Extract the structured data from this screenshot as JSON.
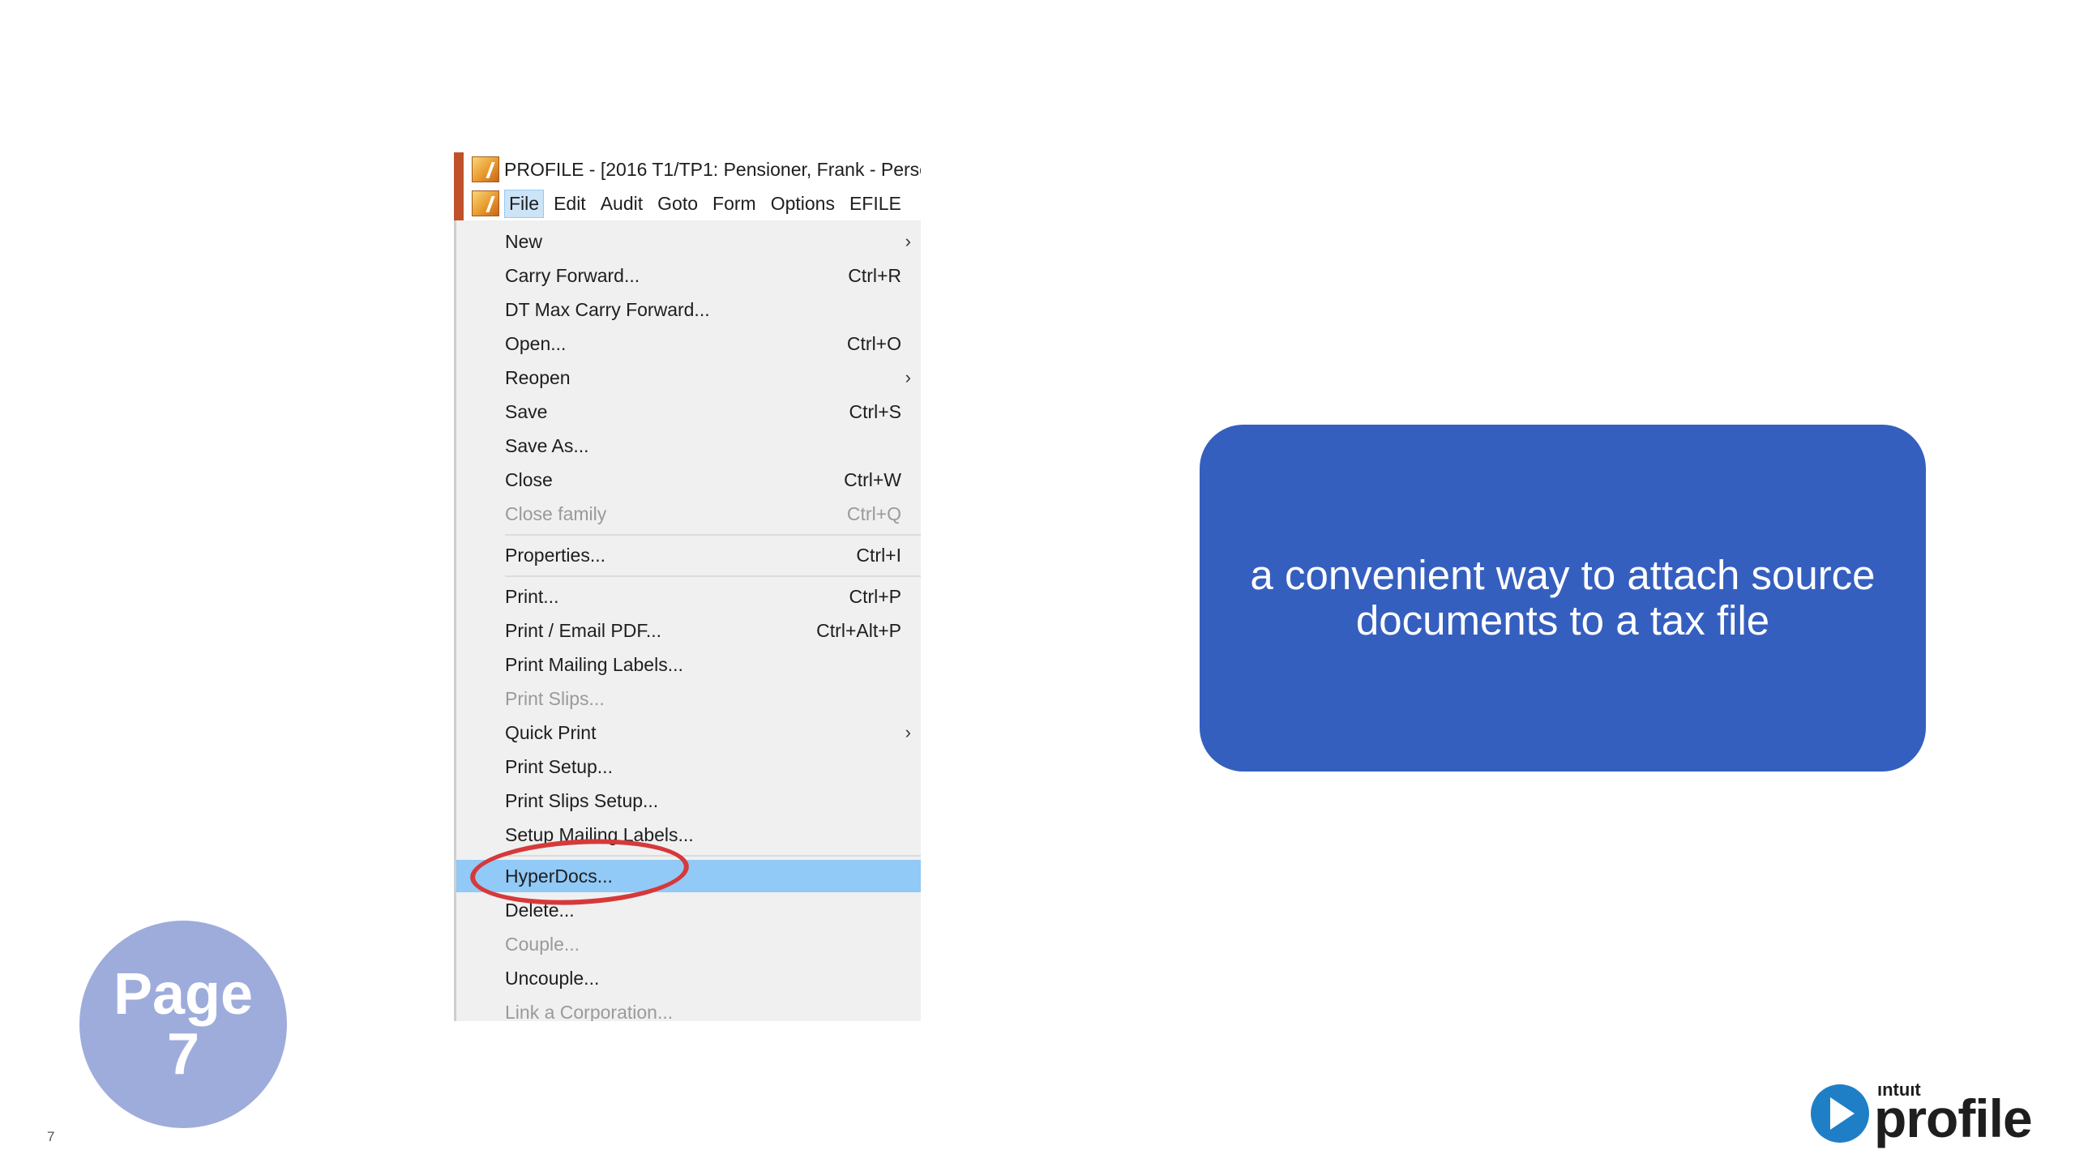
{
  "app": {
    "title": "PROFILE - [2016 T1/TP1: Pensioner, Frank - Perso",
    "menubar": [
      {
        "label": "File",
        "active": true
      },
      {
        "label": "Edit",
        "active": false
      },
      {
        "label": "Audit",
        "active": false
      },
      {
        "label": "Goto",
        "active": false
      },
      {
        "label": "Form",
        "active": false
      },
      {
        "label": "Options",
        "active": false
      },
      {
        "label": "EFILE",
        "active": false
      }
    ],
    "file_menu": [
      {
        "label": "New",
        "shortcut": "",
        "submenu": true,
        "disabled": false
      },
      {
        "label": "Carry Forward...",
        "shortcut": "Ctrl+R",
        "submenu": false,
        "disabled": false
      },
      {
        "label": "DT Max Carry Forward...",
        "shortcut": "",
        "submenu": false,
        "disabled": false
      },
      {
        "label": "Open...",
        "shortcut": "Ctrl+O",
        "submenu": false,
        "disabled": false
      },
      {
        "label": "Reopen",
        "shortcut": "",
        "submenu": true,
        "disabled": false
      },
      {
        "label": "Save",
        "shortcut": "Ctrl+S",
        "submenu": false,
        "disabled": false
      },
      {
        "label": "Save As...",
        "shortcut": "",
        "submenu": false,
        "disabled": false
      },
      {
        "label": "Close",
        "shortcut": "Ctrl+W",
        "submenu": false,
        "disabled": false
      },
      {
        "label": "Close family",
        "shortcut": "Ctrl+Q",
        "submenu": false,
        "disabled": true
      },
      {
        "label": "Properties...",
        "shortcut": "Ctrl+I",
        "submenu": false,
        "disabled": false
      },
      {
        "label": "Print...",
        "shortcut": "Ctrl+P",
        "submenu": false,
        "disabled": false
      },
      {
        "label": "Print / Email PDF...",
        "shortcut": "Ctrl+Alt+P",
        "submenu": false,
        "disabled": false
      },
      {
        "label": "Print Mailing Labels...",
        "shortcut": "",
        "submenu": false,
        "disabled": false
      },
      {
        "label": "Print Slips...",
        "shortcut": "",
        "submenu": false,
        "disabled": true
      },
      {
        "label": "Quick Print",
        "shortcut": "",
        "submenu": true,
        "disabled": false
      },
      {
        "label": "Print Setup...",
        "shortcut": "",
        "submenu": false,
        "disabled": false
      },
      {
        "label": "Print Slips Setup...",
        "shortcut": "",
        "submenu": false,
        "disabled": false
      },
      {
        "label": "Setup Mailing Labels...",
        "shortcut": "",
        "submenu": false,
        "disabled": false
      },
      {
        "label": "HyperDocs...",
        "shortcut": "",
        "submenu": false,
        "disabled": false,
        "highlighted": true
      },
      {
        "label": "Delete...",
        "shortcut": "",
        "submenu": false,
        "disabled": false
      },
      {
        "label": "Couple...",
        "shortcut": "",
        "submenu": false,
        "disabled": true
      },
      {
        "label": "Uncouple...",
        "shortcut": "",
        "submenu": false,
        "disabled": false
      },
      {
        "label": "Link a Corporation...",
        "shortcut": "",
        "submenu": false,
        "disabled": true
      }
    ]
  },
  "callout": {
    "text": "a convenient way to attach source documents to a tax file",
    "color": "#355fbf"
  },
  "page_badge": {
    "line1": "Page",
    "line2": "7",
    "color": "#9eacdc"
  },
  "slide_number": "7",
  "brand": {
    "intuit": "ıntuıt",
    "name": "profile",
    "mark_icon": "play-circle-icon"
  }
}
